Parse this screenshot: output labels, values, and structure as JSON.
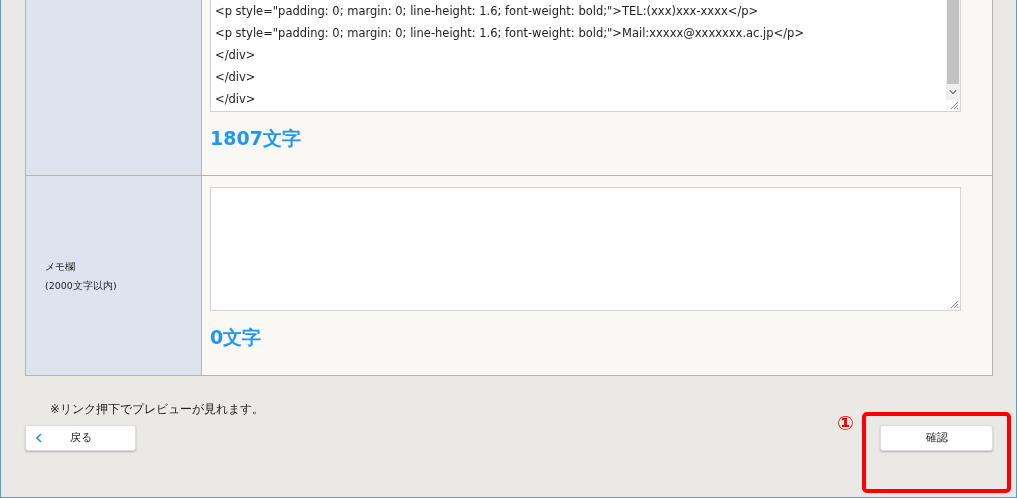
{
  "rows": [
    {
      "label_lines": [],
      "value_lines": [
        "<p style=\"padding: 0; margin: 0; line-height: 1.6; font-weight: bold;\">TEL:(xxx)xxx-xxxx</p>",
        "<p style=\"padding: 0; margin: 0; line-height: 1.6; font-weight: bold;\">Mail:xxxxx@xxxxxxx.ac.jp</p>",
        "</div>",
        "</div>",
        "</div>"
      ],
      "count": "1807文字",
      "scrollbar": true
    },
    {
      "label_lines": [
        "メモ欄",
        "(2000文字以内)"
      ],
      "value_lines": [],
      "count": "0文字",
      "scrollbar": false
    }
  ],
  "note": "※リンク押下でプレビューが見れます。",
  "back_button": {
    "label": "戻る"
  },
  "confirm_button": {
    "label": "確認"
  },
  "callout": {
    "number": "①"
  }
}
